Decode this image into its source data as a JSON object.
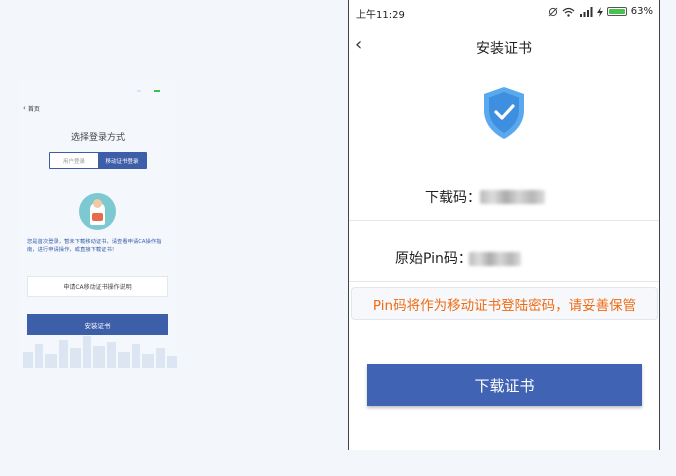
{
  "left_screen": {
    "back_label": "首页",
    "title": "选择登录方式",
    "tabs": [
      {
        "label": "用户登录",
        "active": false
      },
      {
        "label": "移动证书登录",
        "active": true
      }
    ],
    "message": "您是首次登录，暂未下载移动证书，请查看申请CA操作指南，进行申请操作，或直接下载证书！",
    "guide_button": "申请CA移动证书操作说明",
    "install_button": "安装证书"
  },
  "right_screen": {
    "status": {
      "time": "上午11:29",
      "battery": "63%",
      "icons": [
        "mute-icon",
        "wifi-icon",
        "signal-icon",
        "charging-icon",
        "battery-icon"
      ]
    },
    "nav": {
      "title": "安装证书"
    },
    "download_code_label": "下载码：",
    "pin_label": "原始Pin码：",
    "warning": "Pin码将作为移动证书登陆密码，请妥善保管",
    "download_button": "下载证书"
  },
  "colors": {
    "primary": "#4163b4",
    "warning_text": "#f06b12",
    "shield": "#3f8fe0",
    "battery": "#46c34c"
  }
}
